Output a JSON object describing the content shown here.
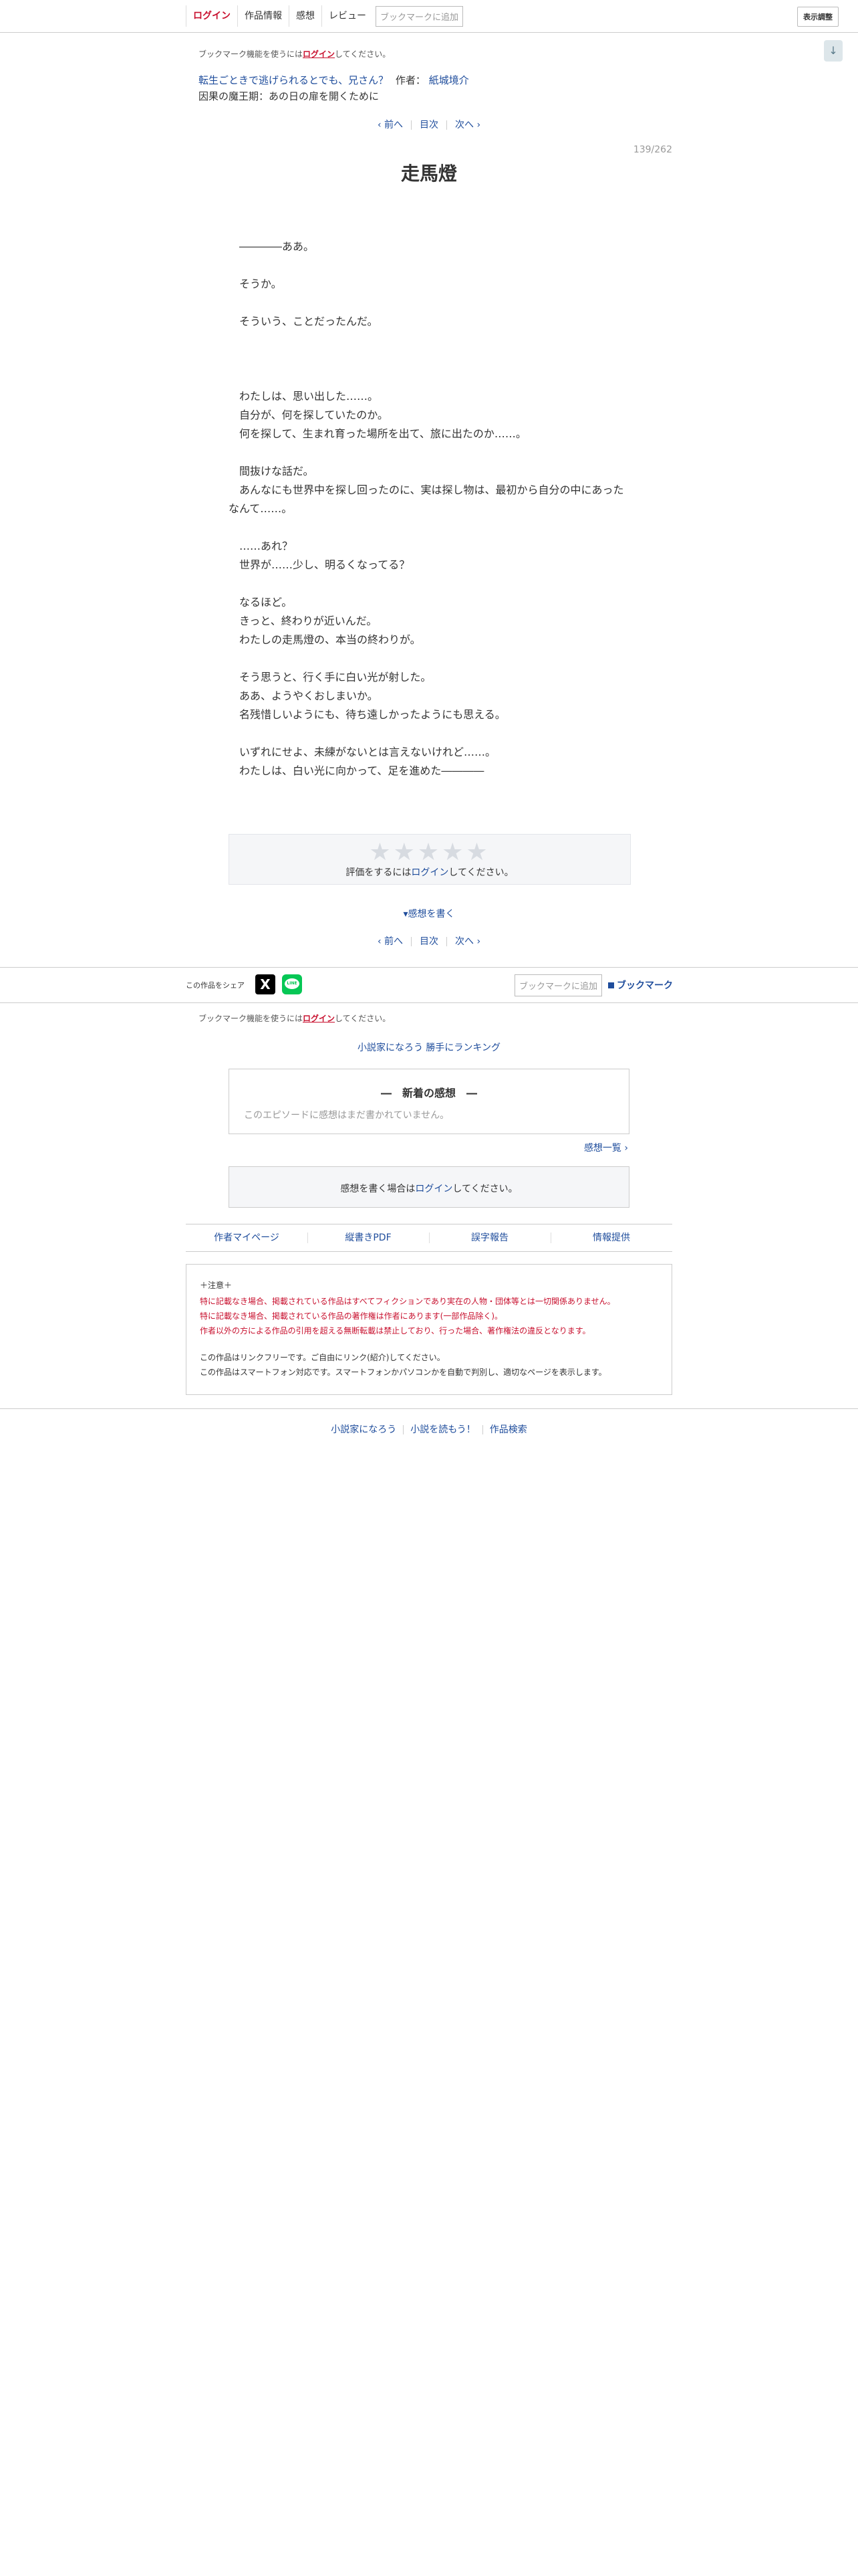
{
  "topnav": {
    "login": "ログイン",
    "work_info": "作品情報",
    "impressions": "感想",
    "review": "レビュー",
    "bookmark_add": "ブックマークに追加",
    "display_adjust": "表示調整"
  },
  "bookmark_note": {
    "prefix": "ブックマーク機能を使うには",
    "login": "ログイン",
    "suffix": "してください。"
  },
  "series": {
    "title": "転生ごときで逃げられるとでも、兄さん？",
    "author_label": "作者：",
    "author": "紙城境介",
    "chapter": "因果の魔王期：あの日の扉を開くために"
  },
  "pager": {
    "prev": "‹ 前へ",
    "toc": "目次",
    "next": "次へ ›"
  },
  "episode": {
    "count": "139/262",
    "title": "走馬燈"
  },
  "body_lines": [
    "　――――ああ。",
    "",
    "　そうか。",
    "",
    "　そういう、ことだったんだ。",
    "",
    "",
    "",
    "　わたしは、思い出した……。",
    "　自分が、何を探していたのか。",
    "　何を探して、生まれ育った場所を出て、旅に出たのか……。",
    "",
    "　間抜けな話だ。",
    "　あんなにも世界中を探し回ったのに、実は探し物は、最初から自分の中にあったなんて……。",
    "",
    "　……あれ？",
    "　世界が……少し、明るくなってる？",
    "",
    "　なるほど。",
    "　きっと、終わりが近いんだ。",
    "　わたしの走馬燈の、本当の終わりが。",
    "",
    "　そう思うと、行く手に白い光が射した。",
    "　ああ、ようやくおしまいか。",
    "　名残惜しいようにも、待ち遠しかったようにも思える。",
    "",
    "　いずれにせよ、未練がないとは言えないけれど……。",
    "　わたしは、白い光に向かって、足を進めた――――"
  ],
  "rating": {
    "stars": "★★★★★",
    "prefix": "評価をするには",
    "login": "ログイン",
    "suffix": "してください。"
  },
  "write_impression": "▾感想を書く",
  "share": {
    "label": "この作品をシェア",
    "x_icon": "x-logo-icon",
    "line_icon": "line-logo-icon",
    "line_text": "LINE",
    "bookmark_add": "ブックマークに追加",
    "bookmark": "ブックマーク"
  },
  "ranking_link": "小説家になろう 勝手にランキング",
  "new_impressions": {
    "heading": "―　新着の感想　―",
    "empty": "このエピソードに感想はまだ書かれていません。",
    "list_link": "感想一覧 ›"
  },
  "impression_login": {
    "prefix": "感想を書く場合は",
    "login": "ログイン",
    "suffix": "してください。"
  },
  "footer_links": [
    "作者マイページ",
    "縦書きPDF",
    "誤字報告",
    "情報提供"
  ],
  "notice": {
    "heading": "＋注意＋",
    "red_lines": [
      "特に記載なき場合、掲載されている作品はすべてフィクションであり実在の人物・団体等とは一切関係ありません。",
      "特に記載なき場合、掲載されている作品の著作権は作者にあります(一部作品除く)。",
      "作者以外の方による作品の引用を超える無断転載は禁止しており、行った場合、著作権法の違反となります。"
    ],
    "black_lines": [
      "この作品はリンクフリーです。ご自由にリンク(紹介)してください。",
      "この作品はスマートフォン対応です。スマートフォンかパソコンかを自動で判別し、適切なページを表示します。"
    ]
  },
  "site_footer": [
    "小説家になろう",
    "小説を読もう！",
    "作品検索"
  ],
  "colors": {
    "link": "#1f4d9c",
    "login_red": "#c8102e",
    "line_green": "#06c755"
  }
}
